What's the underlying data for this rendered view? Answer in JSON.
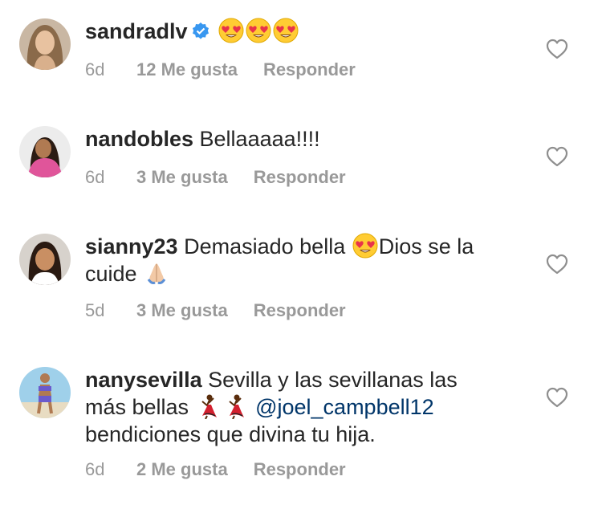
{
  "comments": [
    {
      "username": "sandradlv",
      "verified": true,
      "text": "",
      "time": "6d",
      "likes": "12 Me gusta",
      "reply": "Responder"
    },
    {
      "username": "nandobles",
      "text": "Bellaaaaa!!!!",
      "time": "6d",
      "likes": "3 Me gusta",
      "reply": "Responder"
    },
    {
      "username": "sianny23",
      "text_part1": "Demasiado bella",
      "text_part2": "Dios se la cuide",
      "time": "5d",
      "likes": "3 Me gusta",
      "reply": "Responder"
    },
    {
      "username": "nanysevilla",
      "text_part1": "Sevilla y las sevillanas las más bellas",
      "mention": "@joel_campbell12",
      "text_part2": "bendiciones que divina tu hija.",
      "time": "6d",
      "likes": "2 Me gusta",
      "reply": "Responder"
    }
  ],
  "icons": {
    "verified": "verified-badge-icon",
    "heart": "heart-outline-icon",
    "heart_eyes": "heart-eyes-emoji",
    "praying": "folded-hands-emoji",
    "dancer": "dancer-emoji"
  },
  "colors": {
    "username": "#262626",
    "meta": "#999999",
    "mention": "#003569",
    "verified": "#3897f0"
  }
}
